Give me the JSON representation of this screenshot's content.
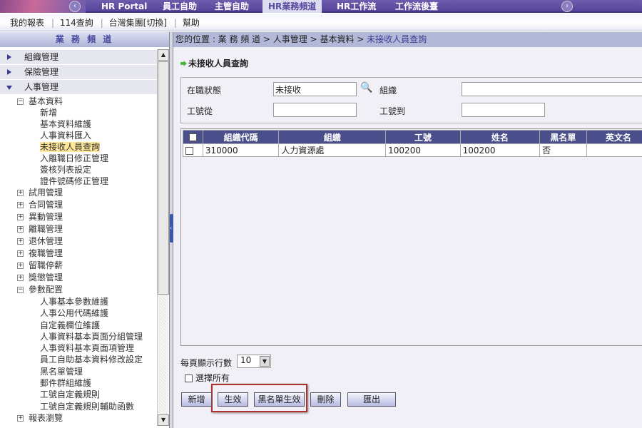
{
  "topnav": {
    "tabs": [
      {
        "label": "HR Portal"
      },
      {
        "label": "員工自助"
      },
      {
        "label": "主管自助"
      },
      {
        "label": "HR業務頻道",
        "active": true
      },
      {
        "label": "HR工作流"
      },
      {
        "label": "工作流後臺"
      }
    ]
  },
  "subnav": {
    "links": [
      "我的報表",
      "114查詢",
      "台灣集團[切換]",
      "幫助"
    ]
  },
  "sidebar": {
    "title": "業 務 頻 道",
    "sections": [
      {
        "label": "組織管理",
        "expanded": false
      },
      {
        "label": "保險管理",
        "expanded": false
      },
      {
        "label": "人事管理",
        "expanded": true
      }
    ],
    "tree": [
      {
        "label": "基本資料",
        "level": 1,
        "toggle": "minus"
      },
      {
        "label": "新增",
        "level": 2
      },
      {
        "label": "基本資料維護",
        "level": 2
      },
      {
        "label": "人事資料匯入",
        "level": 2
      },
      {
        "label": "未接收人員查詢",
        "level": 2,
        "selected": true
      },
      {
        "label": "入離職日修正管理",
        "level": 2
      },
      {
        "label": "簽核列表設定",
        "level": 2
      },
      {
        "label": "證件號碼修正管理",
        "level": 2
      },
      {
        "label": "試用管理",
        "level": 1,
        "toggle": "plus"
      },
      {
        "label": "合同管理",
        "level": 1,
        "toggle": "plus"
      },
      {
        "label": "異動管理",
        "level": 1,
        "toggle": "plus"
      },
      {
        "label": "離職管理",
        "level": 1,
        "toggle": "plus"
      },
      {
        "label": "退休管理",
        "level": 1,
        "toggle": "plus"
      },
      {
        "label": "複職管理",
        "level": 1,
        "toggle": "plus"
      },
      {
        "label": "留職停薪",
        "level": 1,
        "toggle": "plus"
      },
      {
        "label": "獎懲管理",
        "level": 1,
        "toggle": "plus"
      },
      {
        "label": "參數配置",
        "level": 1,
        "toggle": "minus"
      },
      {
        "label": "人事基本參數維護",
        "level": 2
      },
      {
        "label": "人事公用代碼維護",
        "level": 2
      },
      {
        "label": "自定義欄位維護",
        "level": 2
      },
      {
        "label": "人事資料基本頁面分組管理",
        "level": 2
      },
      {
        "label": "人事資料基本頁面項管理",
        "level": 2
      },
      {
        "label": "員工自助基本資料修改設定",
        "level": 2
      },
      {
        "label": "黑名單管理",
        "level": 2
      },
      {
        "label": "郵件群組維護",
        "level": 2
      },
      {
        "label": "工號自定義規則",
        "level": 2
      },
      {
        "label": "工號自定義規則輔助函數",
        "level": 2
      },
      {
        "label": "報表瀏覽",
        "level": 1,
        "toggle": "plus"
      }
    ]
  },
  "breadcrumb": {
    "prefix": "您的位置 : 業 務 頻 道 > 人事管理 > 基本資料 > ",
    "current": "未接收人員查詢"
  },
  "page": {
    "title": "未接收人員查詢"
  },
  "form": {
    "status_label": "在職狀態",
    "status_value": "未接收",
    "org_label": "組織",
    "org_value": "",
    "from_label": "工號從",
    "from_value": "",
    "to_label": "工號到",
    "to_value": ""
  },
  "grid": {
    "columns": [
      "組織代碼",
      "組織",
      "工號",
      "姓名",
      "黑名單",
      "英文名"
    ],
    "rows": [
      [
        "310000",
        "人力資源處",
        "100200",
        "100200",
        "否",
        ""
      ]
    ]
  },
  "pager": {
    "label": "每頁顯示行數",
    "value": "10"
  },
  "select_all": "選擇所有",
  "buttons": [
    "新增",
    "生效",
    "黑名單生效",
    "刪除",
    "匯出"
  ],
  "colors": {
    "nav": "#5b4a9a",
    "header": "#4a4f8c",
    "highlight_box": "#b03030"
  }
}
